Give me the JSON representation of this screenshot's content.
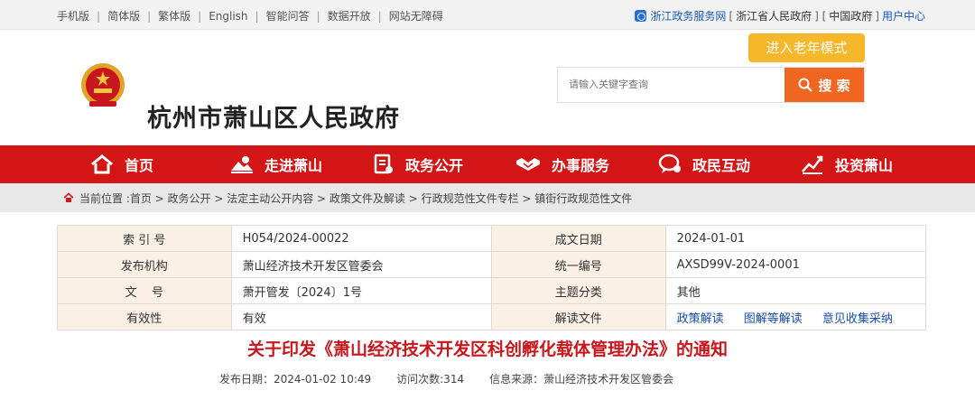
{
  "topbar": {
    "links": [
      "手机版",
      "简体版",
      "繁体版",
      "English",
      "智能问答",
      "数据开放",
      "网站无障碍"
    ],
    "right_prefix": "浙江政务服务网",
    "right_bracket1": "[",
    "right_link1": "浙江省人民政府",
    "right_bracket2": "] [",
    "right_link2": "中国政府",
    "right_bracket3": "]",
    "right_user": "用户中心"
  },
  "header": {
    "site_title": "杭州市萧山区人民政府",
    "elder_mode": "进入老年模式",
    "search_placeholder": "请输入关键字查询",
    "search_button": "搜 索"
  },
  "nav": [
    {
      "label": "首页",
      "icon": "home-icon"
    },
    {
      "label": "走进萧山",
      "icon": "landscape-icon"
    },
    {
      "label": "政务公开",
      "icon": "document-icon"
    },
    {
      "label": "办事服务",
      "icon": "handshake-icon"
    },
    {
      "label": "政民互动",
      "icon": "chat-icon"
    },
    {
      "label": "投资萧山",
      "icon": "chart-icon"
    }
  ],
  "breadcrumb": "当前位置 :首页 > 政务公开 > 法定主动公开内容 > 政策文件及解读 > 行政规范性文件专栏 > 镇街行政规范性文件",
  "info": {
    "rows": [
      {
        "k1": "索 引 号",
        "v1": "H054/2024-00022",
        "k2": "成文日期",
        "v2": "2024-01-01"
      },
      {
        "k1": "发布机构",
        "v1": "萧山经济技术开发区管委会",
        "k2": "统一编号",
        "v2": "AXSD99V-2024-0001"
      },
      {
        "k1": "文    号",
        "v1": "萧开管发〔2024〕1号",
        "k2": "主题分类",
        "v2": "其他"
      },
      {
        "k1": "有效性",
        "v1": "有效",
        "k2": "解读文件"
      }
    ],
    "links": [
      "政策解读",
      "图解等解读",
      "意见收集采纳"
    ]
  },
  "article": {
    "title": "关于印发《萧山经济技术开发区科创孵化载体管理办法》的通知",
    "publish_date": "发布日期：2024-01-02 10:49",
    "visits": "访问次数:314",
    "source": "信息来源：萧山经济技术开发区管委会"
  },
  "colors": {
    "nav_red": "#d31515",
    "accent_orange": "#f0651f",
    "elder_yellow": "#f7b72a",
    "title_red": "#c8161d"
  }
}
